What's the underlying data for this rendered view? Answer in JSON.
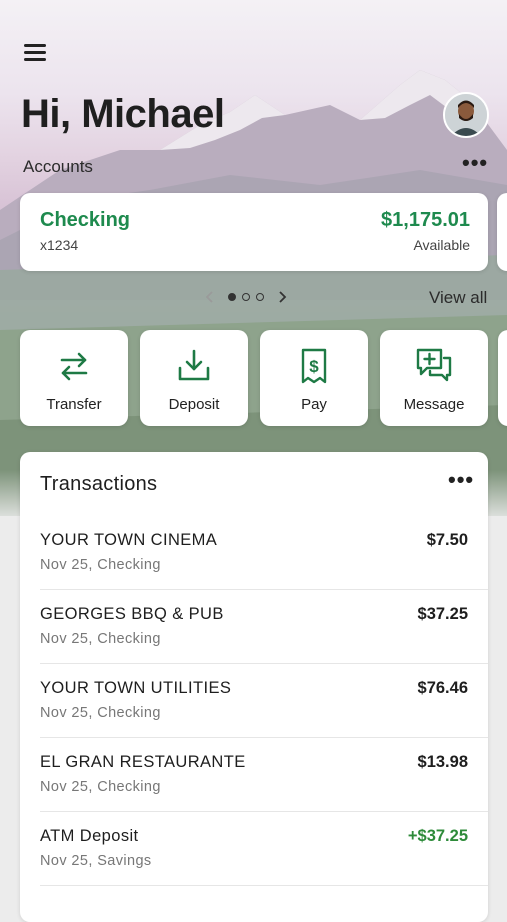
{
  "header": {
    "greeting": "Hi, Michael",
    "accounts_label": "Accounts"
  },
  "account": {
    "name": "Checking",
    "number": "x1234",
    "balance": "$1,175.01",
    "balance_label": "Available"
  },
  "pager": {
    "pages": 3,
    "active_index": 0,
    "view_all": "View all"
  },
  "quick_actions": [
    {
      "label": "Transfer",
      "icon": "transfer-icon"
    },
    {
      "label": "Deposit",
      "icon": "deposit-icon"
    },
    {
      "label": "Pay",
      "icon": "pay-icon"
    },
    {
      "label": "Message",
      "icon": "message-icon"
    }
  ],
  "transactions": {
    "title": "Transactions",
    "items": [
      {
        "name": "YOUR TOWN CINEMA",
        "sub": "Nov 25, Checking",
        "amount": "$7.50",
        "credit": false
      },
      {
        "name": "GEORGES BBQ & PUB",
        "sub": "Nov 25, Checking",
        "amount": "$37.25",
        "credit": false
      },
      {
        "name": "YOUR TOWN UTILITIES",
        "sub": "Nov 25, Checking",
        "amount": "$76.46",
        "credit": false
      },
      {
        "name": "EL GRAN RESTAURANTE",
        "sub": "Nov 25, Checking",
        "amount": "$13.98",
        "credit": false
      },
      {
        "name": "ATM Deposit",
        "sub": "Nov 25, Savings",
        "amount": "+$37.25",
        "credit": true
      }
    ]
  },
  "colors": {
    "brand_green": "#1e8a4e",
    "credit_green": "#2e8b3a",
    "icon_green": "#1e7a45"
  }
}
